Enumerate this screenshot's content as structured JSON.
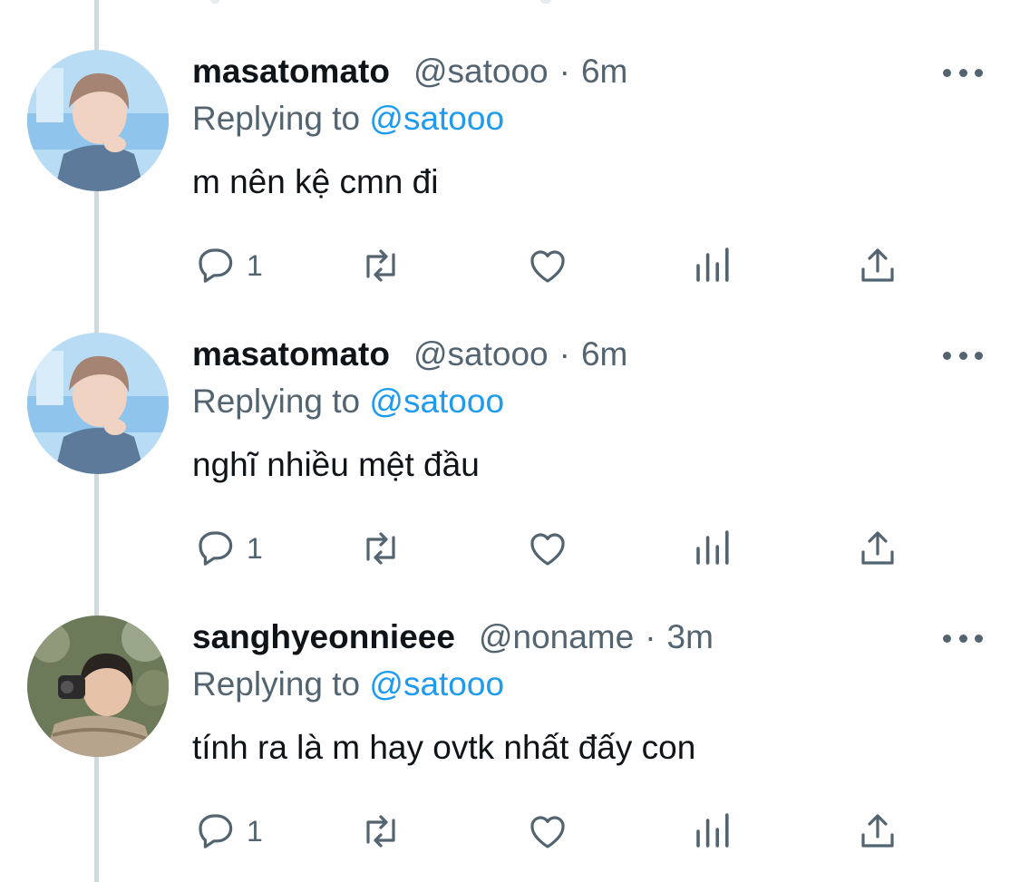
{
  "tweets": [
    {
      "name": "masatomato",
      "handle": "@satooo",
      "separator": "·",
      "time": "6m",
      "replying_prefix": "Replying to",
      "replying_to": "@satooo",
      "text": "m nên kệ cmn đi",
      "reply_count": "1",
      "avatar": "avatar-masatomato"
    },
    {
      "name": "masatomato",
      "handle": "@satooo",
      "separator": "·",
      "time": "6m",
      "replying_prefix": "Replying to",
      "replying_to": "@satooo",
      "text": "nghĩ nhiều mệt đầu",
      "reply_count": "1",
      "avatar": "avatar-masatomato"
    },
    {
      "name": "sanghyeonnieee",
      "handle": "@noname",
      "separator": "·",
      "time": "3m",
      "replying_prefix": "Replying to",
      "replying_to": "@satooo",
      "text": "tính ra là m hay ovtk nhất đấy con",
      "reply_count": "1",
      "avatar": "avatar-sanghyeonnieee"
    }
  ],
  "icons": {
    "reply": "speech-bubble-icon",
    "retweet": "retweet-icon",
    "like": "heart-icon",
    "views": "bar-chart-icon",
    "share": "share-icon",
    "more": "more-dots-icon"
  },
  "colors": {
    "text": "#0f1419",
    "secondary": "#536471",
    "accent": "#1d9bf0",
    "thread_line": "#cfd9de"
  }
}
